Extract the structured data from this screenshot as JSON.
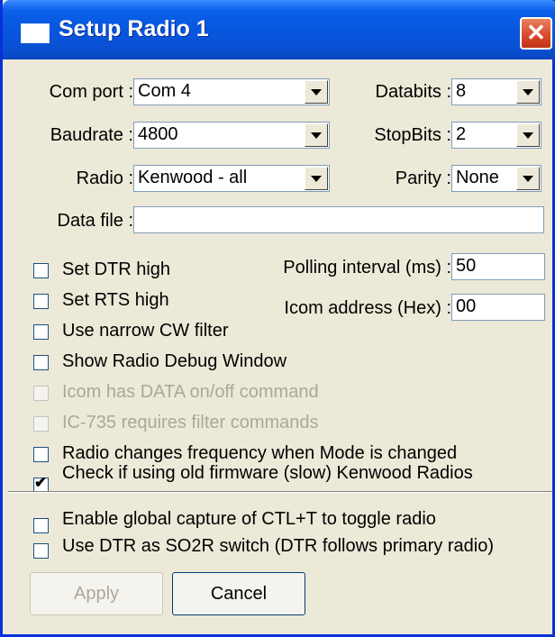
{
  "window": {
    "title": "Setup Radio 1",
    "close_glyph": "✕"
  },
  "fields": {
    "com_port": {
      "label": "Com port :",
      "value": "Com 4"
    },
    "baudrate": {
      "label": "Baudrate :",
      "value": "4800"
    },
    "radio": {
      "label": "Radio :",
      "value": "Kenwood - all"
    },
    "databits": {
      "label": "Databits :",
      "value": "8"
    },
    "stopbits": {
      "label": "StopBits :",
      "value": "2"
    },
    "parity": {
      "label": "Parity :",
      "value": "None"
    },
    "data_file": {
      "label": "Data file :",
      "value": ""
    },
    "polling_interval": {
      "label": "Polling interval (ms) :",
      "value": "50"
    },
    "icom_address": {
      "label": "Icom address (Hex) :",
      "value": "00"
    }
  },
  "checkboxes": [
    {
      "label": "Set DTR high",
      "checked": false,
      "enabled": true
    },
    {
      "label": "Set RTS high",
      "checked": false,
      "enabled": true
    },
    {
      "label": "Use narrow CW filter",
      "checked": false,
      "enabled": true
    },
    {
      "label": "Show Radio Debug Window",
      "checked": false,
      "enabled": true
    },
    {
      "label": "Icom has DATA on/off command",
      "checked": false,
      "enabled": false
    },
    {
      "label": "IC-735 requires filter commands",
      "checked": false,
      "enabled": false
    },
    {
      "label": "Radio changes frequency when Mode is changed",
      "checked": false,
      "enabled": true
    },
    {
      "label": "Check if using old firmware (slow) Kenwood Radios",
      "checked": true,
      "enabled": true
    },
    {
      "label": "Enable global capture of CTL+T to toggle radio",
      "checked": false,
      "enabled": true
    },
    {
      "label": "Use DTR as SO2R switch (DTR follows primary radio)",
      "checked": false,
      "enabled": true
    }
  ],
  "buttons": {
    "apply": {
      "label": "Apply",
      "enabled": false
    },
    "cancel": {
      "label": "Cancel",
      "enabled": true
    }
  },
  "colors": {
    "title_bar": "#0855dd",
    "dialog_bg": "#ece9d8",
    "close_button": "#d6472b"
  },
  "icons": {
    "check_glyph": "✔"
  }
}
